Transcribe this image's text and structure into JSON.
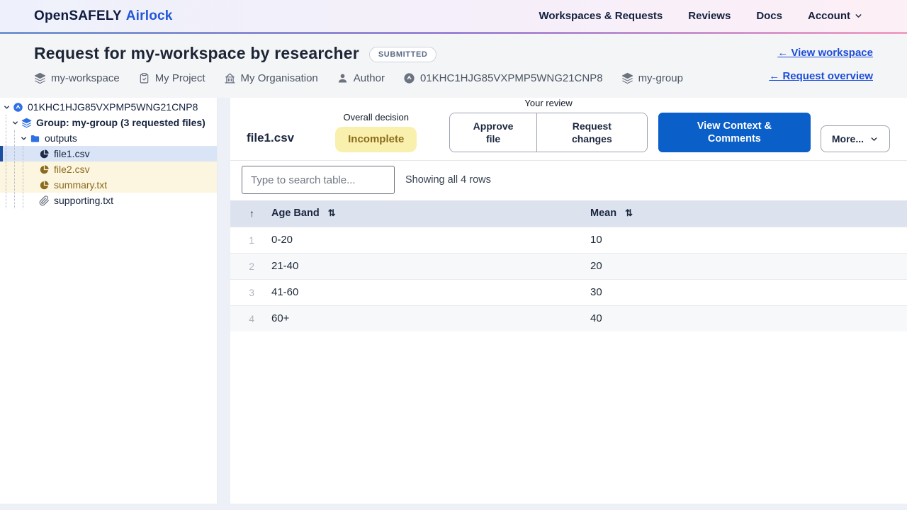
{
  "navbar": {
    "brand": {
      "primary": "OpenSAFELY",
      "secondary": "Airlock"
    },
    "items": [
      {
        "label": "Workspaces & Requests"
      },
      {
        "label": "Reviews"
      },
      {
        "label": "Docs"
      },
      {
        "label": "Account"
      }
    ]
  },
  "header": {
    "title": "Request for my-workspace by researcher",
    "status_badge": "SUBMITTED",
    "meta": [
      {
        "icon": "layers-icon",
        "label": "my-workspace"
      },
      {
        "icon": "clipboard-icon",
        "label": "My Project"
      },
      {
        "icon": "organisation-icon",
        "label": "My Organisation"
      },
      {
        "icon": "user-icon",
        "label": "Author"
      },
      {
        "icon": "package-icon",
        "label": "01KHC1HJG85VXPMP5WNG21CNP8"
      },
      {
        "icon": "layers-icon",
        "label": "my-group"
      }
    ],
    "links": [
      {
        "label": "← View workspace"
      },
      {
        "label": "← Request overview"
      }
    ]
  },
  "sidebar": {
    "tree": [
      {
        "label": "01KHC1HJG85VXPMP5WNG21CNP8",
        "icon": "request-icon",
        "level": 0,
        "expanded": true
      },
      {
        "label": "Group: my-group (3 requested files)",
        "icon": "layers-icon",
        "level": 1,
        "expanded": true
      },
      {
        "label": "outputs",
        "icon": "folder-icon",
        "level": 2,
        "expanded": true
      },
      {
        "label": "file1.csv",
        "icon": "pie-chart-icon",
        "level": 3,
        "state": "selected"
      },
      {
        "label": "file2.csv",
        "icon": "pie-chart-icon",
        "level": 3,
        "state": "flagged"
      },
      {
        "label": "summary.txt",
        "icon": "pie-chart-icon",
        "level": 3,
        "state": "flagged"
      },
      {
        "label": "supporting.txt",
        "icon": "paperclip-icon",
        "level": 3,
        "state": "normal"
      }
    ]
  },
  "main": {
    "file_title": "file1.csv",
    "overall_decision": {
      "label": "Overall decision",
      "value": "Incomplete"
    },
    "your_review": {
      "label": "Your review",
      "approve_label": "Approve file",
      "request_changes_label": "Request changes"
    },
    "view_context_label": "View Context & Comments",
    "more_label": "More...",
    "search": {
      "placeholder": "Type to search table...",
      "status": "Showing all 4 rows"
    },
    "table": {
      "columns": {
        "band": "Age Band",
        "mean": "Mean"
      },
      "sort_up_glyph": "↑",
      "sort_pair_glyph": "⇅",
      "rows": [
        {
          "num": "1",
          "band": "0-20",
          "mean": "10"
        },
        {
          "num": "2",
          "band": "21-40",
          "mean": "20"
        },
        {
          "num": "3",
          "band": "41-60",
          "mean": "30"
        },
        {
          "num": "4",
          "band": "60+",
          "mean": "40"
        }
      ]
    }
  },
  "colors": {
    "accent_blue": "#0a5fc8",
    "link_blue": "#1d4ed8",
    "brand_navy": "#101b3e",
    "brand_blue": "#2257d6",
    "status_yellow_bg": "#faf0ae",
    "status_yellow_text": "#8a6d1a",
    "selected_row_bg": "#d9e4f6",
    "selected_row_bar": "#1d4fa1",
    "flagged_row_bg": "#fcf5df",
    "flagged_row_text": "#8a6b1f",
    "table_header_bg": "#dce3ee",
    "navbar_gradient": [
      "#6f94cf",
      "#9a83d6",
      "#f09ec4"
    ]
  }
}
